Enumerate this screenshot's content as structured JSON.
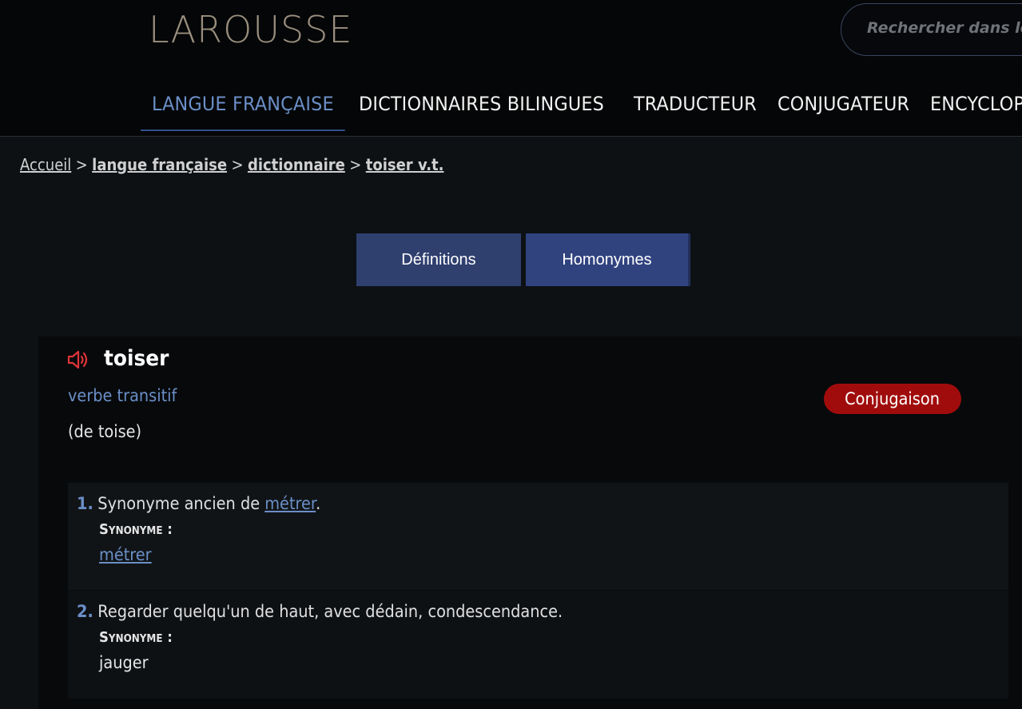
{
  "header": {
    "logo": "LAROUSSE",
    "search_placeholder": "Rechercher dans le dictionnaire",
    "nav": [
      {
        "label": "LANGUE FRANÇAISE",
        "active": true
      },
      {
        "label": "DICTIONNAIRES BILINGUES",
        "active": false
      },
      {
        "label": "TRADUCTEUR",
        "active": false
      },
      {
        "label": "CONJUGATEUR",
        "active": false
      },
      {
        "label": "ENCYCLOPÉDIE",
        "active": false
      }
    ]
  },
  "breadcrumb": {
    "items": [
      "Accueil",
      "langue française",
      "dictionnaire",
      "toiser v.t."
    ],
    "separator": ">"
  },
  "tabs": {
    "definitions": "Définitions",
    "homonymes": "Homonymes"
  },
  "entry": {
    "speaker_icon": "speaker-icon",
    "headword": "toiser",
    "part_of_speech": "verbe transitif",
    "etymology": "(de toise)",
    "conjugation_button": "Conjugaison",
    "definitions": [
      {
        "number": "1.",
        "text_before": "Synonyme ancien de ",
        "link": "métrer",
        "text_after": ".",
        "synonym_label": "Synonyme :",
        "synonym": "métrer"
      },
      {
        "number": "2.",
        "text": "Regarder quelqu'un de haut, avec dédain, condescendance.",
        "synonym_label": "Synonyme :",
        "synonym": "jauger"
      }
    ]
  },
  "colors": {
    "accent_blue": "#6b8fc7",
    "tab_bg": "#2f3f6e",
    "conjugation_red": "#a00c0c",
    "logo": "#9a8f7e"
  }
}
